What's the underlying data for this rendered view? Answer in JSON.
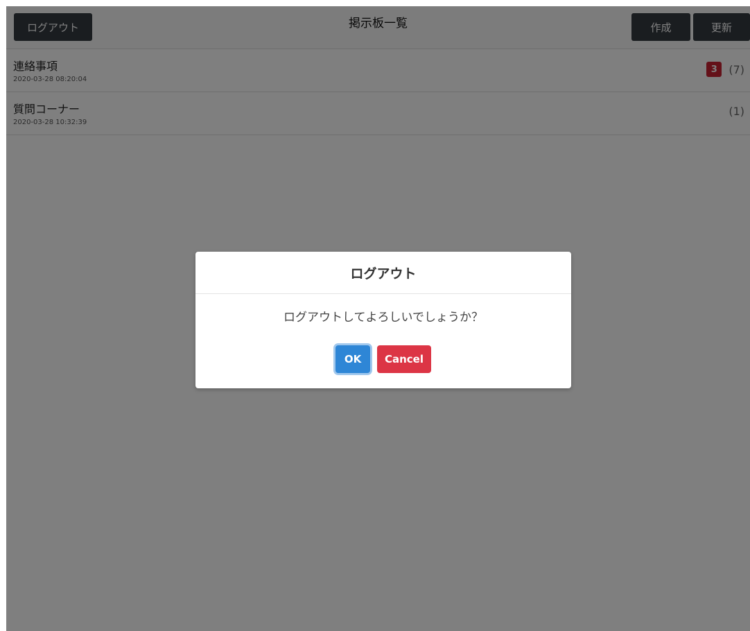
{
  "header": {
    "logout_label": "ログアウト",
    "title": "掲示板一覧",
    "create_label": "作成",
    "refresh_label": "更新"
  },
  "boards": [
    {
      "title": "連絡事項",
      "date": "2020-03-28 08:20:04",
      "unread": "3",
      "count": "(7)"
    },
    {
      "title": "質問コーナー",
      "date": "2020-03-28 10:32:39",
      "unread": "",
      "count": "(1)"
    }
  ],
  "dialog": {
    "title": "ログアウト",
    "message": "ログアウトしてよろしいでしょうか？",
    "ok_label": "OK",
    "cancel_label": "Cancel"
  },
  "colors": {
    "header_button": "#343a40",
    "unread_badge": "#c82333",
    "ok_button": "#2e86d6",
    "cancel_button": "#dc3545"
  }
}
